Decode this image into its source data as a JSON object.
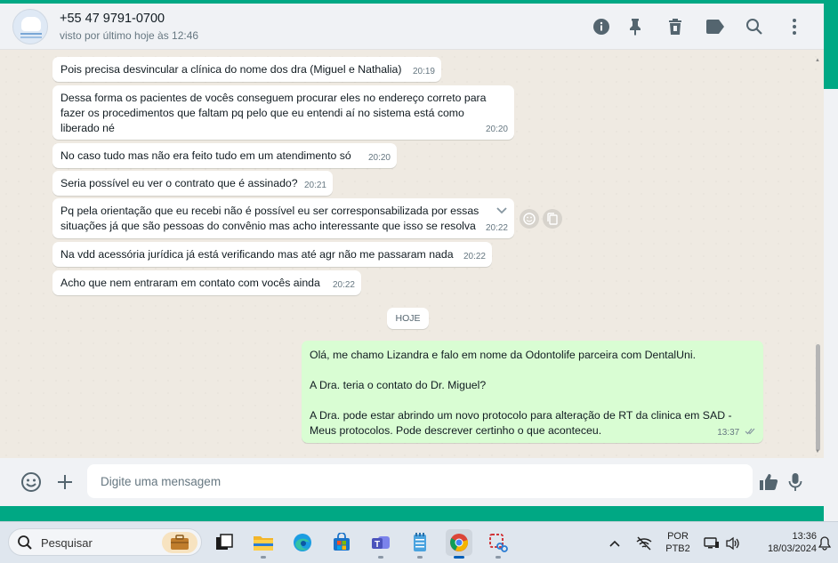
{
  "header": {
    "contact_name": "+55 47 9791-0700",
    "contact_status": "visto por último hoje às 12:46",
    "icons": [
      "info-icon",
      "pin-icon",
      "delete-icon",
      "label-icon",
      "search-icon",
      "menu-icon"
    ]
  },
  "messages": [
    {
      "text": "Pois precisa desvincular a clínica do nome dos dra (Miguel e Nathalia)",
      "time": "20:19"
    },
    {
      "text": "Dessa forma os pacientes de vocês conseguem procurar eles no endereço correto para\nfazer os procedimentos que faltam pq pelo que eu entendi aí no sistema está como\nliberado né",
      "time": "20:20"
    },
    {
      "text": "No caso tudo mas não era feito tudo em um atendimento só",
      "time": "20:20"
    },
    {
      "text": "Seria possível eu ver o contrato que é assinado?",
      "time": "20:21"
    },
    {
      "text": "Pq pela orientação que eu recebi não é possível eu ser corresponsabilizada por essas\nsituações já que são pessoas do convênio mas acho interessante que isso se resolva",
      "time": "20:22"
    },
    {
      "text": "Na vdd acessória jurídica já está verificando mas até agr não me passaram nada",
      "time": "20:22"
    },
    {
      "text": "Acho que nem entraram em contato com vocês ainda",
      "time": "20:22"
    }
  ],
  "day_chip": "HOJE",
  "outgoing": {
    "text": "Olá, me chamo Lizandra e falo em nome da Odontolife parceira com DentalUni.\n\nA Dra. teria o contato do Dr. Miguel?\n\nA Dra. pode estar abrindo um novo protocolo para alteração de RT da clinica em SAD -\nMeus protocolos. Pode descrever certinho o que aconteceu.",
    "time": "13:37"
  },
  "composer": {
    "placeholder": "Digite uma mensagem"
  },
  "taskbar": {
    "search_label": "Pesquisar",
    "language": "POR",
    "layout": "PTB2",
    "time": "13:36",
    "date": "18/03/2024"
  }
}
